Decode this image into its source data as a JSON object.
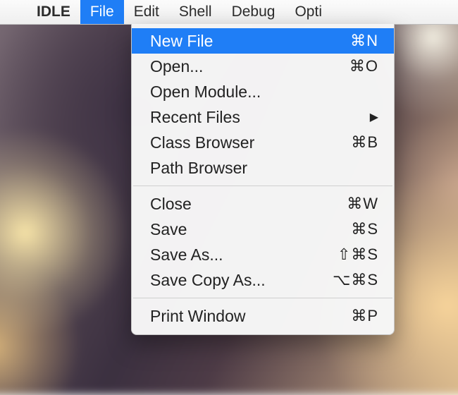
{
  "menubar": {
    "app_name": "IDLE",
    "items": [
      {
        "label": "File",
        "selected": true
      },
      {
        "label": "Edit",
        "selected": false
      },
      {
        "label": "Shell",
        "selected": false
      },
      {
        "label": "Debug",
        "selected": false
      },
      {
        "label": "Opti",
        "selected": false
      }
    ]
  },
  "file_menu": {
    "groups": [
      [
        {
          "label": "New File",
          "shortcut": "⌘N",
          "selected": true
        },
        {
          "label": "Open...",
          "shortcut": "⌘O"
        },
        {
          "label": "Open Module...",
          "shortcut": ""
        },
        {
          "label": "Recent Files",
          "shortcut": "",
          "submenu": true
        },
        {
          "label": "Class Browser",
          "shortcut": "⌘B"
        },
        {
          "label": "Path Browser",
          "shortcut": ""
        }
      ],
      [
        {
          "label": "Close",
          "shortcut": "⌘W"
        },
        {
          "label": "Save",
          "shortcut": "⌘S"
        },
        {
          "label": "Save As...",
          "shortcut": "⇧⌘S"
        },
        {
          "label": "Save Copy As...",
          "shortcut": "⌥⌘S"
        }
      ],
      [
        {
          "label": "Print Window",
          "shortcut": "⌘P"
        }
      ]
    ]
  }
}
